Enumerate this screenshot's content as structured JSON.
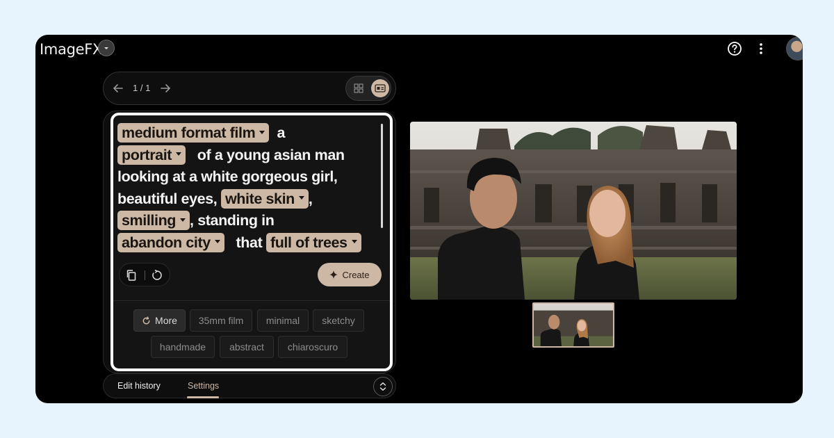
{
  "app": {
    "title": "ImageFX",
    "icons": {
      "title_dropdown": "chevron-down-icon",
      "help": "help-circle-icon",
      "more": "more-vert-icon",
      "avatar": "user-avatar"
    }
  },
  "pager": {
    "count": "1 / 1",
    "icons": {
      "prev": "arrow-left-icon",
      "next": "arrow-right-icon",
      "grid": "grid-view-icon",
      "single": "single-view-icon"
    }
  },
  "prompt": {
    "chips": {
      "medium_format_film": "medium format film",
      "portrait": "portrait",
      "white_skin": "white skin",
      "smilling": "smilling",
      "abandon_city": "abandon city",
      "full_of_trees": "full of trees"
    },
    "text": {
      "a": "a",
      "of_a_young": "of a young asian man",
      "looking_line": "looking at a white gorgeous girl,",
      "beautiful_eyes": "beautiful eyes,",
      "comma": ",",
      "standing_in": ", standing in",
      "that": "that"
    }
  },
  "actions": {
    "create_label": "Create",
    "icons": {
      "copy": "copy-icon",
      "reset": "reset-icon",
      "create": "sparkle-icon"
    }
  },
  "style_chips": {
    "more": "More",
    "items": [
      "35mm film",
      "minimal",
      "sketchy",
      "handmade",
      "abstract",
      "chiaroscuro"
    ]
  },
  "bottom_tabs": {
    "edit_history": "Edit history",
    "settings": "Settings",
    "icons": {
      "expand": "unfold-icon"
    }
  },
  "colors": {
    "accent": "#cdb8a6",
    "background": "#000000",
    "page": "#e8f4fd"
  }
}
